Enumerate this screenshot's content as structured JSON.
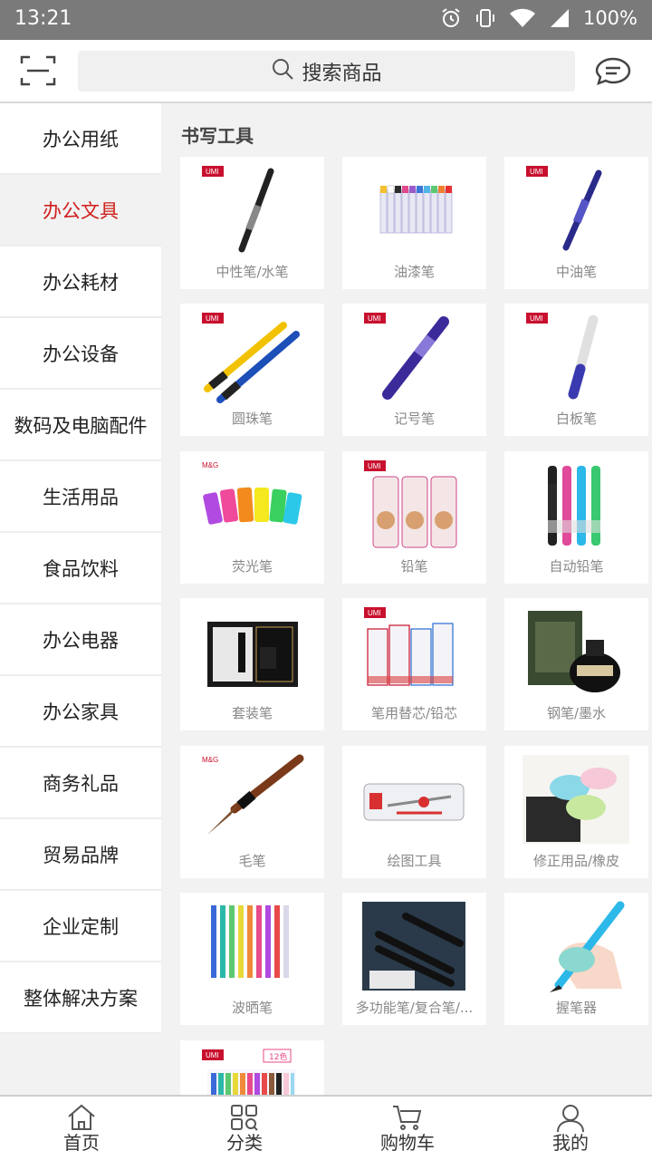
{
  "status": {
    "time": "13:21",
    "battery": "100%"
  },
  "search": {
    "placeholder": "搜索商品"
  },
  "sidebar": {
    "items": [
      {
        "label": "办公用纸"
      },
      {
        "label": "办公文具",
        "active": true
      },
      {
        "label": "办公耗材"
      },
      {
        "label": "办公设备"
      },
      {
        "label": "数码及电脑配件"
      },
      {
        "label": "生活用品"
      },
      {
        "label": "食品饮料"
      },
      {
        "label": "办公电器"
      },
      {
        "label": "办公家具"
      },
      {
        "label": "商务礼品"
      },
      {
        "label": "贸易品牌"
      },
      {
        "label": "企业定制"
      },
      {
        "label": "整体解决方案"
      }
    ]
  },
  "section": {
    "title": "书写工具"
  },
  "products": [
    {
      "label": "中性笔/水笔",
      "icon": "gel-pen"
    },
    {
      "label": "油漆笔",
      "icon": "paint-markers"
    },
    {
      "label": "中油笔",
      "icon": "ballpoint-pen"
    },
    {
      "label": "圆珠笔",
      "icon": "two-pens"
    },
    {
      "label": "记号笔",
      "icon": "marker"
    },
    {
      "label": "白板笔",
      "icon": "whiteboard-pen"
    },
    {
      "label": "荧光笔",
      "icon": "highlighters"
    },
    {
      "label": "铅笔",
      "icon": "pencil-boxes"
    },
    {
      "label": "自动铅笔",
      "icon": "mechanical-pencils"
    },
    {
      "label": "套装笔",
      "icon": "pen-set"
    },
    {
      "label": "笔用替芯/铅芯",
      "icon": "refill-boxes"
    },
    {
      "label": "钢笔/墨水",
      "icon": "ink-bottle"
    },
    {
      "label": "毛笔",
      "icon": "brush"
    },
    {
      "label": "绘图工具",
      "icon": "drawing-tools"
    },
    {
      "label": "修正用品/橡皮",
      "icon": "correction-tape"
    },
    {
      "label": "波晒笔",
      "icon": "colored-gel-pens"
    },
    {
      "label": "多功能笔/复合笔/...",
      "icon": "multi-pens"
    },
    {
      "label": "握笔器",
      "icon": "pen-grip"
    },
    {
      "label": "",
      "icon": "color-pens-12"
    }
  ],
  "tabbar": {
    "home": "首页",
    "category": "分类",
    "cart": "购物车",
    "mine": "我的"
  },
  "colors": {
    "accent": "#d0201d",
    "statusbar": "#7a7a7a"
  }
}
